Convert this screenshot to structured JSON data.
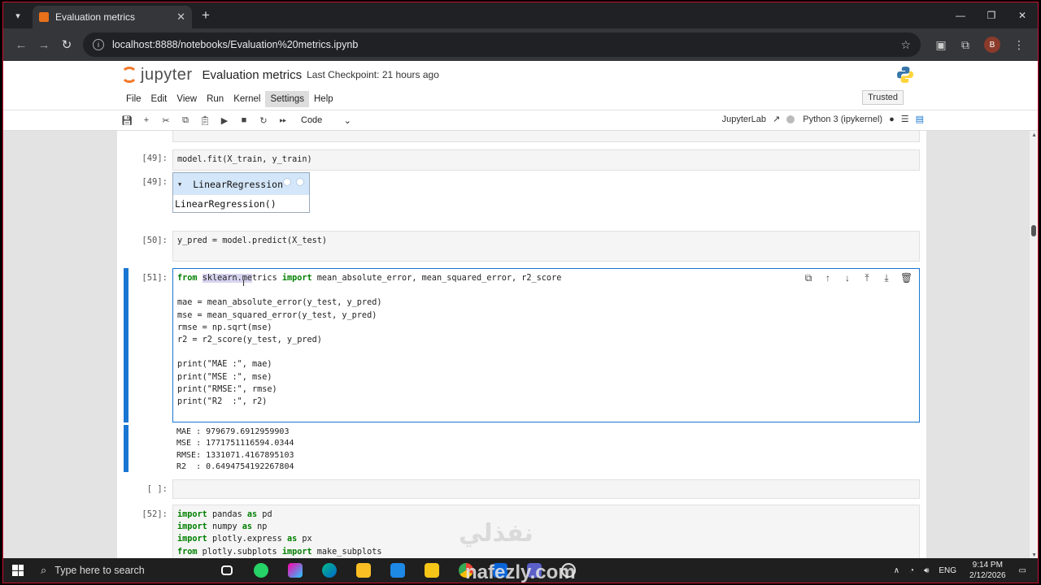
{
  "browser": {
    "tab_title": "Evaluation metrics",
    "url": "localhost:8888/notebooks/Evaluation%20metrics.ipynb",
    "profile_initial": "B"
  },
  "jupyter": {
    "logo_text": "jupyter",
    "notebook_name": "Evaluation metrics",
    "checkpoint": "Last Checkpoint: 21 hours ago",
    "menu": [
      "File",
      "Edit",
      "View",
      "Run",
      "Kernel",
      "Settings",
      "Help"
    ],
    "selected_menu": "Settings",
    "trusted_label": "Trusted",
    "cell_type": "Code",
    "jupyterlab_link": "JupyterLab",
    "kernel_name": "Python 3 (ipykernel)"
  },
  "cells": {
    "c49_prompt": "[49]:",
    "c49_code": "model.fit(X_train, y_train)",
    "c49_out_prompt": "[49]:",
    "widget_title": "LinearRegression",
    "widget_body": "LinearRegression()",
    "c50_prompt": "[50]:",
    "c50_code": "y_pred = model.predict(X_test)",
    "c51_prompt": "[51]:",
    "c51_lines": [
      "from sklearn.metrics import mean_absolute_error, mean_squared_error, r2_score",
      "",
      "mae = mean_absolute_error(y_test, y_pred)",
      "mse = mean_squared_error(y_test, y_pred)",
      "rmse = np.sqrt(mse)",
      "r2 = r2_score(y_test, y_pred)",
      "",
      "print(\"MAE :\", mae)",
      "print(\"MSE :\", mse)",
      "print(\"RMSE:\", rmse)",
      "print(\"R2  :\", r2)"
    ],
    "c51_output": [
      "MAE : 979679.6912959903",
      "MSE : 1771751116594.0344",
      "RMSE: 1331071.4167895103",
      "R2  : 0.6494754192267804"
    ],
    "empty_prompt": "[ ]:",
    "c52_prompt": "[52]:",
    "c52_lines": [
      "import pandas as pd",
      "import numpy as np",
      "import plotly.express as px",
      "from plotly.subplots import make_subplots"
    ]
  },
  "taskbar": {
    "search_placeholder": "Type here to search",
    "language": "ENG",
    "time": "9:14 PM",
    "date": "2/12/2026"
  },
  "watermark": {
    "arabic": "نفذلي",
    "latin": "nafezly.com"
  }
}
